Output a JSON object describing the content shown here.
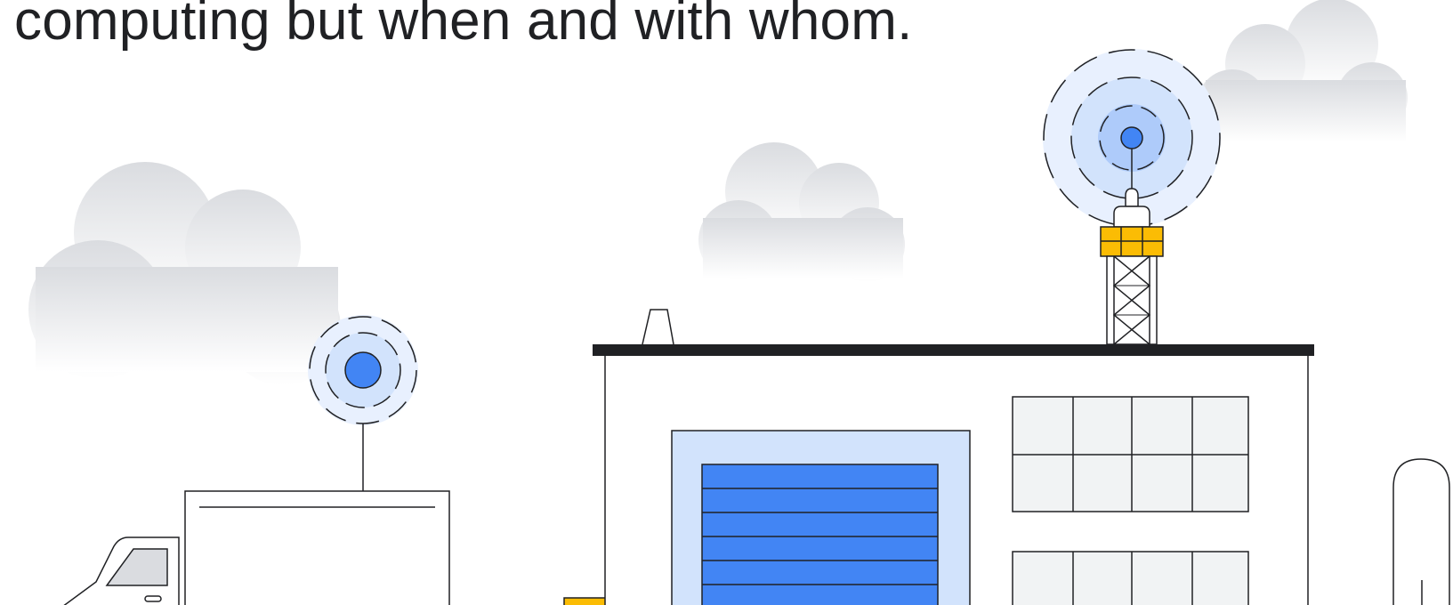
{
  "headline": {
    "text": "computing but when and with whom."
  },
  "icons": [
    "cloud-icon",
    "signal-antenna-icon",
    "delivery-truck-icon",
    "warehouse-building-icon",
    "garage-door-icon",
    "window-grid-icon",
    "cell-tower-icon",
    "rooftop-vent-icon",
    "street-lamp-icon"
  ],
  "colors": {
    "text": "#202124",
    "outline": "#202124",
    "accent_blue": "#4285f4",
    "light_blue": "#d2e3fc",
    "pale_blue": "#e8f0fe",
    "mid_blue": "#aecbfa",
    "yellow": "#fbbc04",
    "window_gray": "#f1f3f4",
    "cloud_gray": "#dadce0"
  }
}
